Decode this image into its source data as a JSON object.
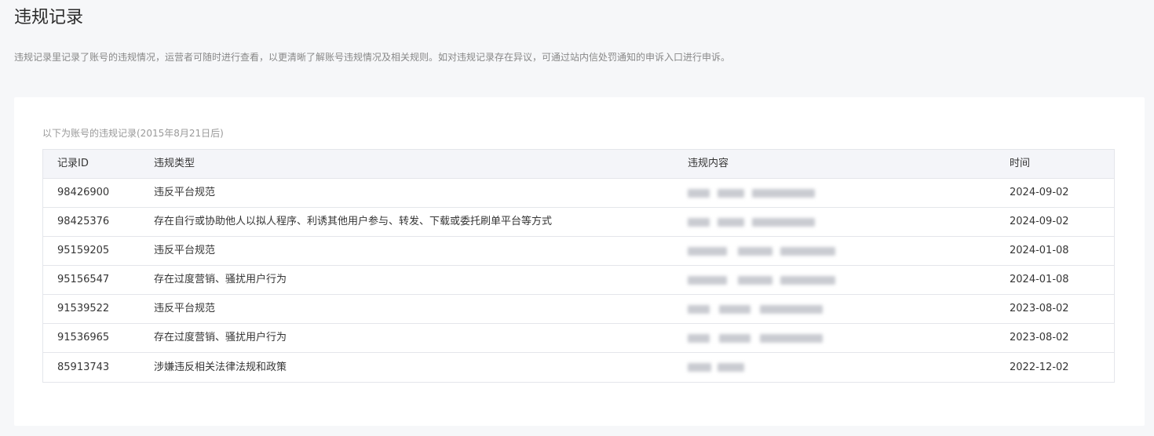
{
  "page": {
    "title": "违规记录",
    "description": "违规记录里记录了账号的违规情况，运营者可随时进行查看，以更清晰了解账号违规情况及相关规则。如对违规记录存在异议，可通过站内信处罚通知的申诉入口进行申诉。"
  },
  "table": {
    "caption": "以下为账号的违规记录(2015年8月21日后)",
    "headers": {
      "id": "记录ID",
      "type": "违规类型",
      "content": "违规内容",
      "time": "时间"
    },
    "rows": [
      {
        "id": "98426900",
        "type": "违反平台规范",
        "time": "2024-09-02"
      },
      {
        "id": "98425376",
        "type": "存在自行或协助他人以拟人程序、利诱其他用户参与、转发、下载或委托刷单平台等方式",
        "time": "2024-09-02"
      },
      {
        "id": "95159205",
        "type": "违反平台规范",
        "time": "2024-01-08"
      },
      {
        "id": "95156547",
        "type": "存在过度营销、骚扰用户行为",
        "time": "2024-01-08"
      },
      {
        "id": "91539522",
        "type": "违反平台规范",
        "time": "2023-08-02"
      },
      {
        "id": "91536965",
        "type": "存在过度营销、骚扰用户行为",
        "time": "2023-08-02"
      },
      {
        "id": "85913743",
        "type": "涉嫌违反相关法律法规和政策",
        "time": "2022-12-02"
      }
    ]
  },
  "colors": {
    "background": "#f6f7f9",
    "card": "#ffffff",
    "header_row": "#f4f5f9",
    "border": "#e4e6eb",
    "muted_text": "#888888"
  }
}
